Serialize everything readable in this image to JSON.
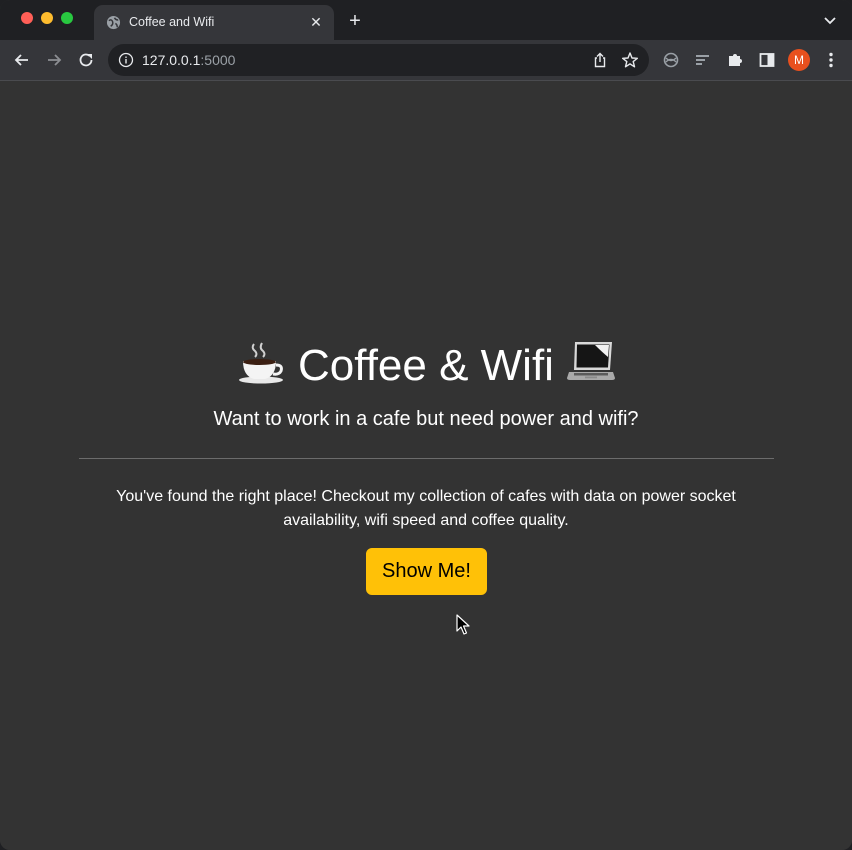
{
  "browser": {
    "tab": {
      "title": "Coffee and Wifi",
      "close": "✕",
      "favicon": "globe-icon"
    },
    "new_tab": "+",
    "address": {
      "host": "127.0.0.1",
      "port": ":5000"
    },
    "profile_initial": "M",
    "colors": {
      "tab_bg": "#35363a",
      "frame_bg": "#1f2023",
      "avatar": "#e8501e"
    }
  },
  "hero": {
    "title": "Coffee & Wifi",
    "title_icons": [
      "coffee-cup-icon",
      "laptop-icon"
    ],
    "lead": "Want to work in a cafe but need power and wifi?",
    "body": "You've found the right place! Checkout my collection of cafes with data on power socket availability, wifi speed and coffee quality.",
    "button_label": "Show Me!",
    "colors": {
      "page_bg": "#333333",
      "button_bg": "#ffc107",
      "text": "#ffffff"
    }
  }
}
